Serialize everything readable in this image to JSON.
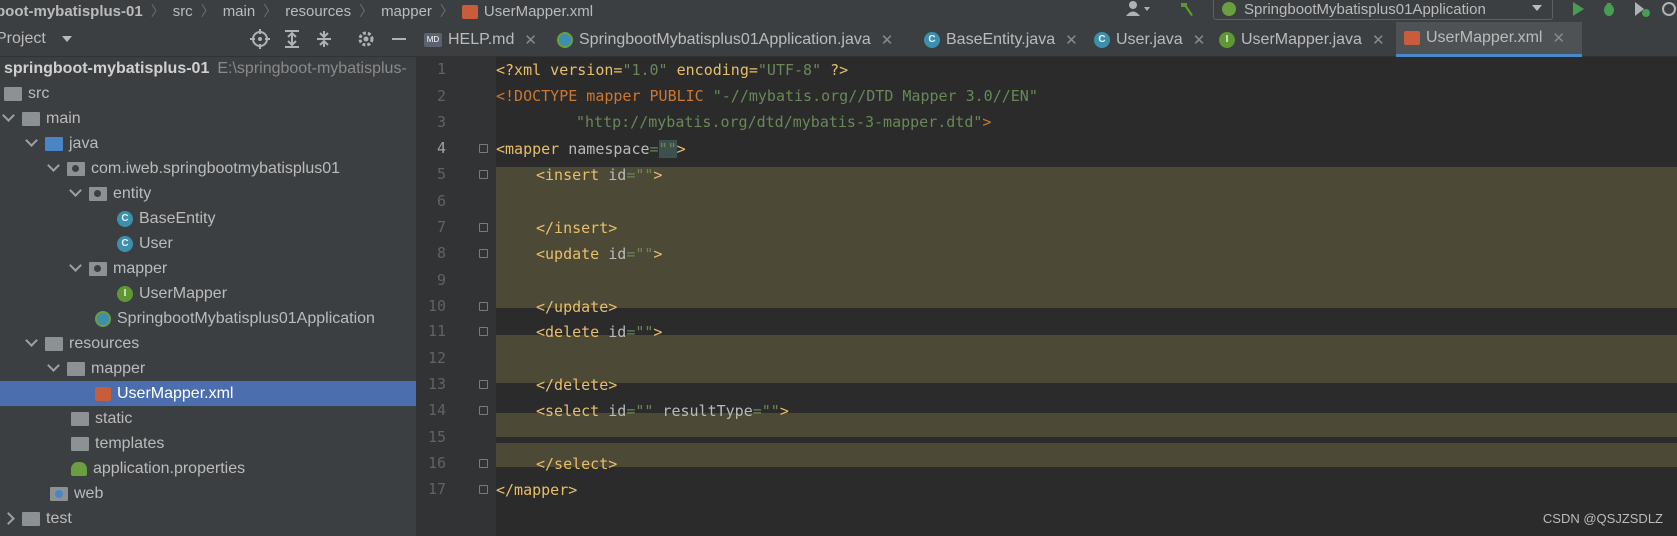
{
  "breadcrumb": [
    "boot-mybatisplus-01",
    "src",
    "main",
    "resources",
    "mapper",
    "UserMapper.xml"
  ],
  "run_config": "SpringbootMybatisplus01Application",
  "project_panel": {
    "title": "Project",
    "tree": [
      {
        "label": "springboot-mybatisplus-01",
        "path": "E:\\springboot-mybatisplus-"
      },
      {
        "label": "src"
      },
      {
        "label": "main"
      },
      {
        "label": "java"
      },
      {
        "label": "com.iweb.springbootmybatisplus01"
      },
      {
        "label": "entity"
      },
      {
        "label": "BaseEntity"
      },
      {
        "label": "User"
      },
      {
        "label": "mapper"
      },
      {
        "label": "UserMapper"
      },
      {
        "label": "SpringbootMybatisplus01Application"
      },
      {
        "label": "resources"
      },
      {
        "label": "mapper"
      },
      {
        "label": "UserMapper.xml"
      },
      {
        "label": "static"
      },
      {
        "label": "templates"
      },
      {
        "label": "application.properties"
      },
      {
        "label": "web"
      },
      {
        "label": "test"
      }
    ]
  },
  "tabs": [
    {
      "label": "HELP.md"
    },
    {
      "label": "SpringbootMybatisplus01Application.java"
    },
    {
      "label": "BaseEntity.java"
    },
    {
      "label": "User.java"
    },
    {
      "label": "UserMapper.java"
    },
    {
      "label": "UserMapper.xml"
    }
  ],
  "editor": {
    "line_numbers": [
      "1",
      "2",
      "3",
      "4",
      "5",
      "6",
      "7",
      "8",
      "9",
      "10",
      "11",
      "12",
      "13",
      "14",
      "15",
      "16",
      "17"
    ],
    "lines": {
      "l1": {
        "a": "<?xml version=",
        "b": "\"1.0\"",
        "c": " encoding=",
        "d": "\"UTF-8\"",
        "e": " ?>"
      },
      "l2": {
        "a": "<!DOCTYPE mapper PUBLIC ",
        "b": "\"-//mybatis.org//DTD Mapper 3.0//EN\""
      },
      "l3": {
        "a": "\"http://mybatis.org/dtd/mybatis-3-mapper.dtd\"",
        "b": ">"
      },
      "l4": {
        "a": "<mapper ",
        "b": "namespace",
        "c": "=",
        "d": "\"\"",
        "e": ">"
      },
      "l5": {
        "a": "<insert ",
        "b": "id",
        "c": "=",
        "d": "\"\"",
        "e": ">"
      },
      "l7": {
        "a": "</insert>"
      },
      "l8": {
        "a": "<update ",
        "b": "id",
        "c": "=",
        "d": "\"\"",
        "e": ">"
      },
      "l10": {
        "a": "</update>"
      },
      "l11": {
        "a": "<delete ",
        "b": "id",
        "c": "=",
        "d": "\"\"",
        "e": ">"
      },
      "l13": {
        "a": "</delete>"
      },
      "l14": {
        "a": "<select ",
        "b": "id",
        "c": "=",
        "d": "\"\"",
        "e": " resultType",
        "f": "=",
        "g": "\"\"",
        "h": ">"
      },
      "l16": {
        "a": "</select>"
      },
      "l17": {
        "a": "</mapper>"
      }
    }
  },
  "watermark": "CSDN @QSJZSDLZ"
}
